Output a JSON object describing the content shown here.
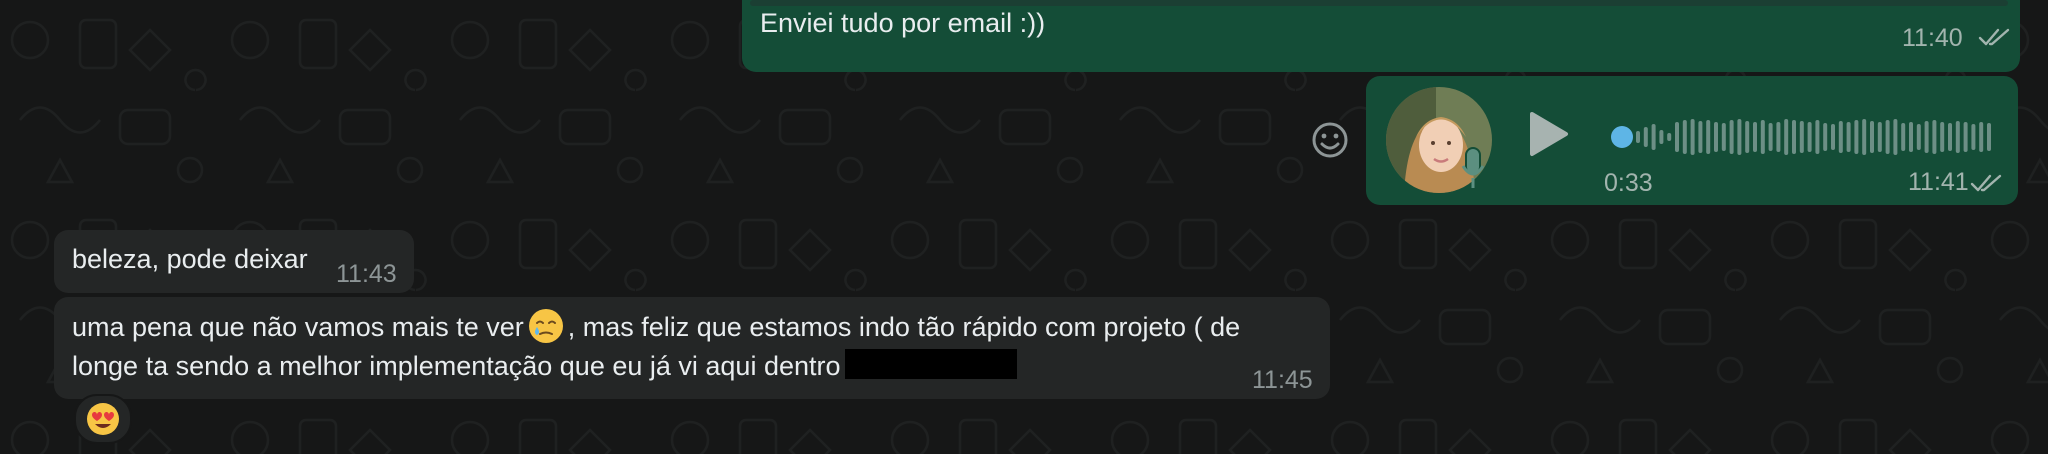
{
  "messages": {
    "m1": {
      "text": "Enviei tudo por email :))",
      "time": "11:40",
      "status": "read"
    },
    "voice": {
      "duration": "0:33",
      "time": "11:41",
      "status": "read",
      "progress": 0
    },
    "m2": {
      "text": "beleza, pode deixar",
      "time": "11:43"
    },
    "m3": {
      "text_part1": "uma pena que não vamos mais te ver",
      "emoji_inline": "face-holding-back-tears",
      "text_part2": ", mas feliz que estamos indo tão rápido com projeto ( de",
      "text_line2": "longe ta sendo a melhor implementação que eu já vi aqui dentro",
      "time": "11:45",
      "reaction": "smiling-face-with-heart-eyes"
    }
  },
  "colors": {
    "outgoing_bubble": "#144d37",
    "incoming_bubble": "#242626",
    "read_ticks": "#a2b4ae",
    "waveform_accent": "#5eb5e6"
  },
  "icons": {
    "react": "smile-icon",
    "play": "play-icon",
    "mic": "mic-icon",
    "ticks": "double-check-icon"
  }
}
